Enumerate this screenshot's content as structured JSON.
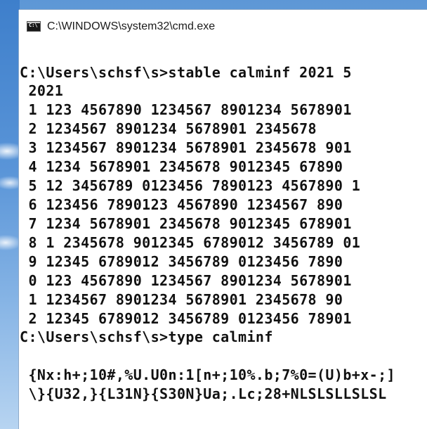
{
  "window": {
    "title": "C:\\WINDOWS\\system32\\cmd.exe",
    "icon": "command-prompt-icon"
  },
  "console": {
    "lines": [
      "C:\\Users\\schsf\\s>stable calminf 2021 5",
      " 2021",
      " 1 123 4567890 1234567 8901234 5678901",
      " 2 1234567 8901234 5678901 2345678",
      " 3 1234567 8901234 5678901 2345678 901",
      " 4 1234 5678901 2345678 9012345 67890",
      " 5 12 3456789 0123456 7890123 4567890 1",
      " 6 123456 7890123 4567890 1234567 890",
      " 7 1234 5678901 2345678 9012345 678901",
      " 8 1 2345678 9012345 6789012 3456789 01",
      " 9 12345 6789012 3456789 0123456 7890",
      " 0 123 4567890 1234567 8901234 5678901",
      " 1 1234567 8901234 5678901 2345678 90",
      " 2 12345 6789012 3456789 0123456 78901",
      "C:\\Users\\schsf\\s>type calminf",
      "",
      " {Nx:h+;10#,%U.U0n:1[n+;10%.b;7%0=(U)b+x-;]",
      " \\}{U32,}{L31N}{S30N}Ua;.Lc;28+NLSLSLLSLSL"
    ]
  }
}
